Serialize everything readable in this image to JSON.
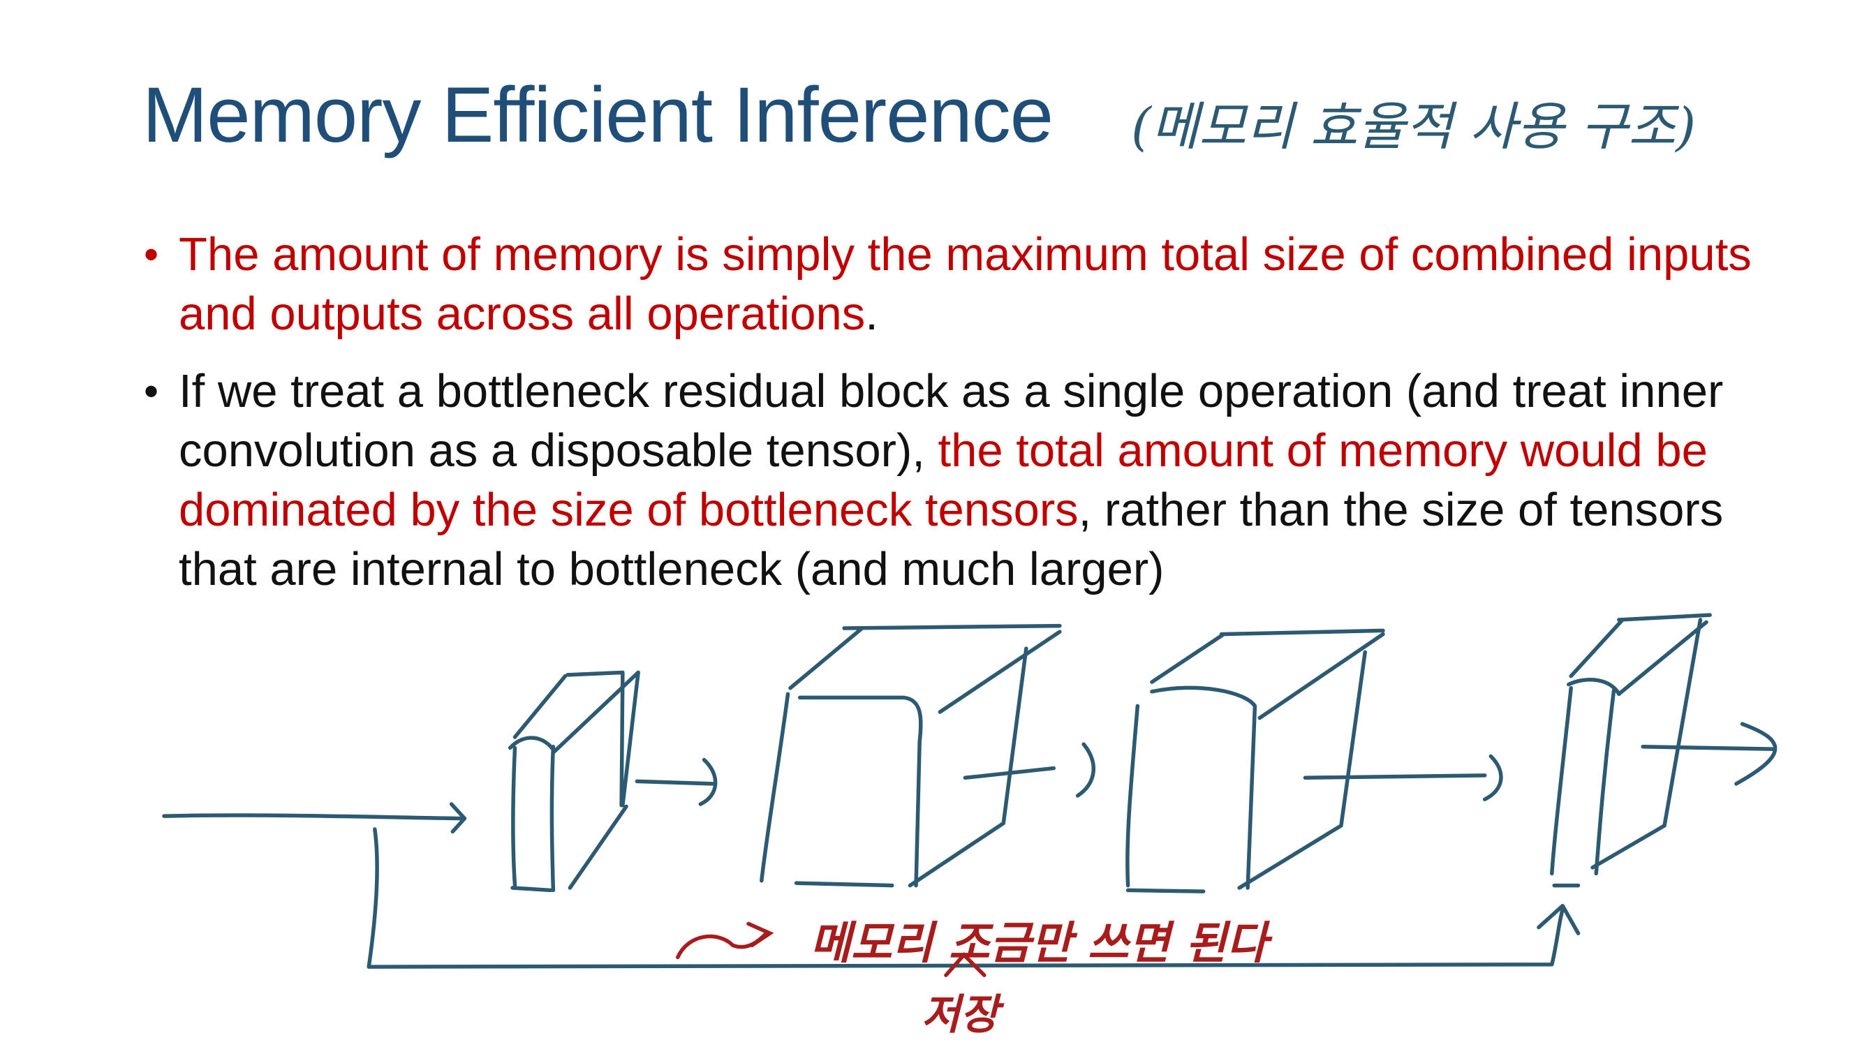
{
  "slide": {
    "title": "Memory Efficient Inference",
    "title_annotation": "(메모리 효율적 사용 구조)",
    "bullets": [
      {
        "red_text": "The amount of memory is simply the maximum total size of combined inputs and outputs across all operations",
        "tail": "."
      },
      {
        "text_1": "If we treat a bottleneck residual block as a single operation (and treat inner convolution as a disposable tensor), ",
        "red_text": "the total amount of memory would be dominated by the size of bottleneck tensors",
        "text_2": ", rather than the size of tensors that are internal to bottleneck (and much larger)"
      }
    ],
    "annotations": {
      "note_main": "메모리 조금만 쓰면 된다",
      "note_sub": "저장"
    },
    "colors": {
      "title": "#1f4e79",
      "red": "#c00000",
      "sketch": "#2b5a72",
      "note": "#a81c1c"
    }
  }
}
